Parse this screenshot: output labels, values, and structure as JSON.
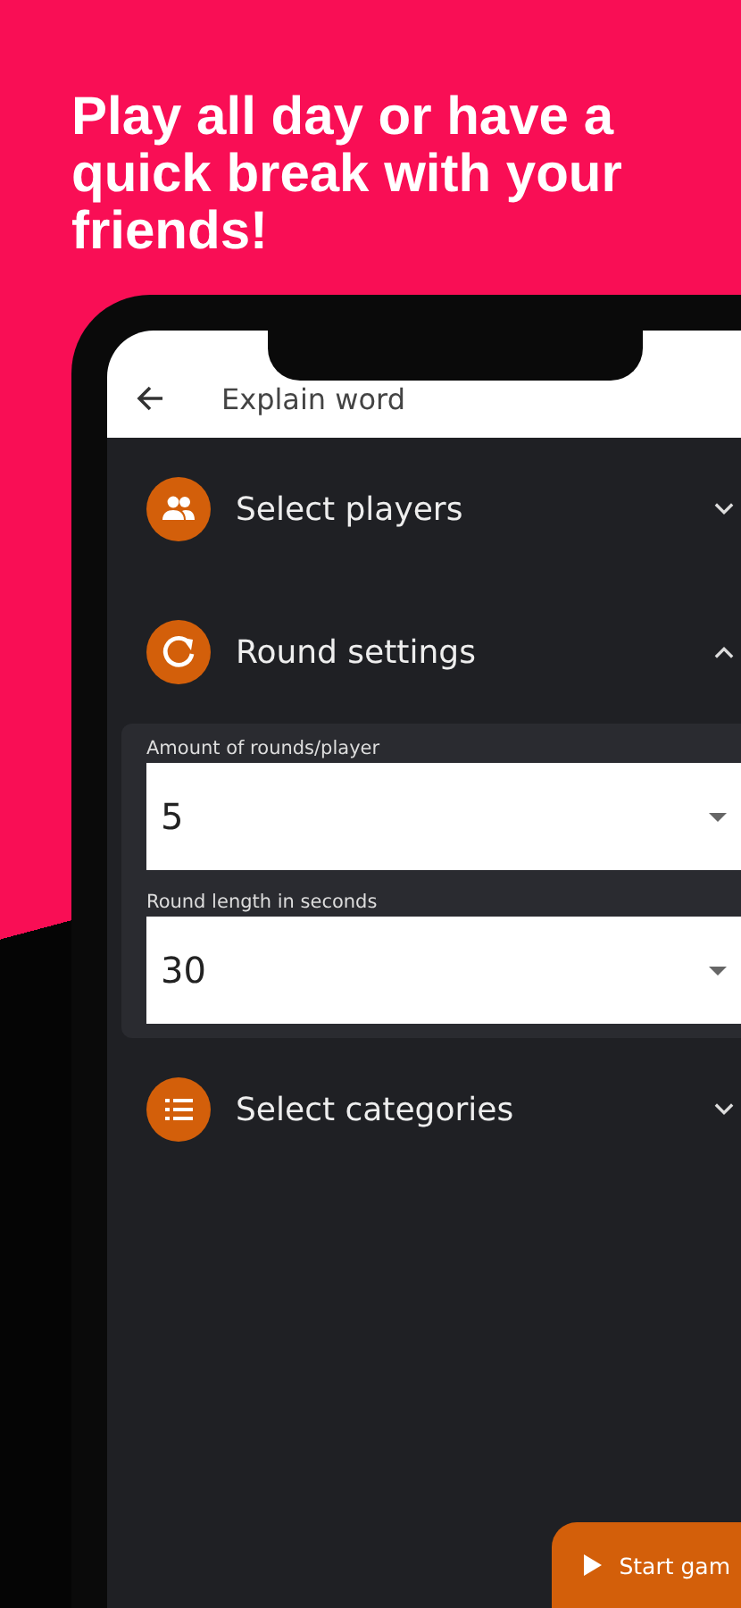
{
  "headline": "Play all day or have a quick break with your friends!",
  "app_bar": {
    "title": "Explain word"
  },
  "sections": [
    {
      "title": "Select players",
      "expanded": false
    },
    {
      "title": "Round settings",
      "expanded": true,
      "fields": [
        {
          "label": "Amount of rounds/player",
          "value": "5"
        },
        {
          "label": "Round length in seconds",
          "value": "30"
        }
      ]
    },
    {
      "title": "Select categories",
      "expanded": false
    }
  ],
  "start_button": "Start gam"
}
